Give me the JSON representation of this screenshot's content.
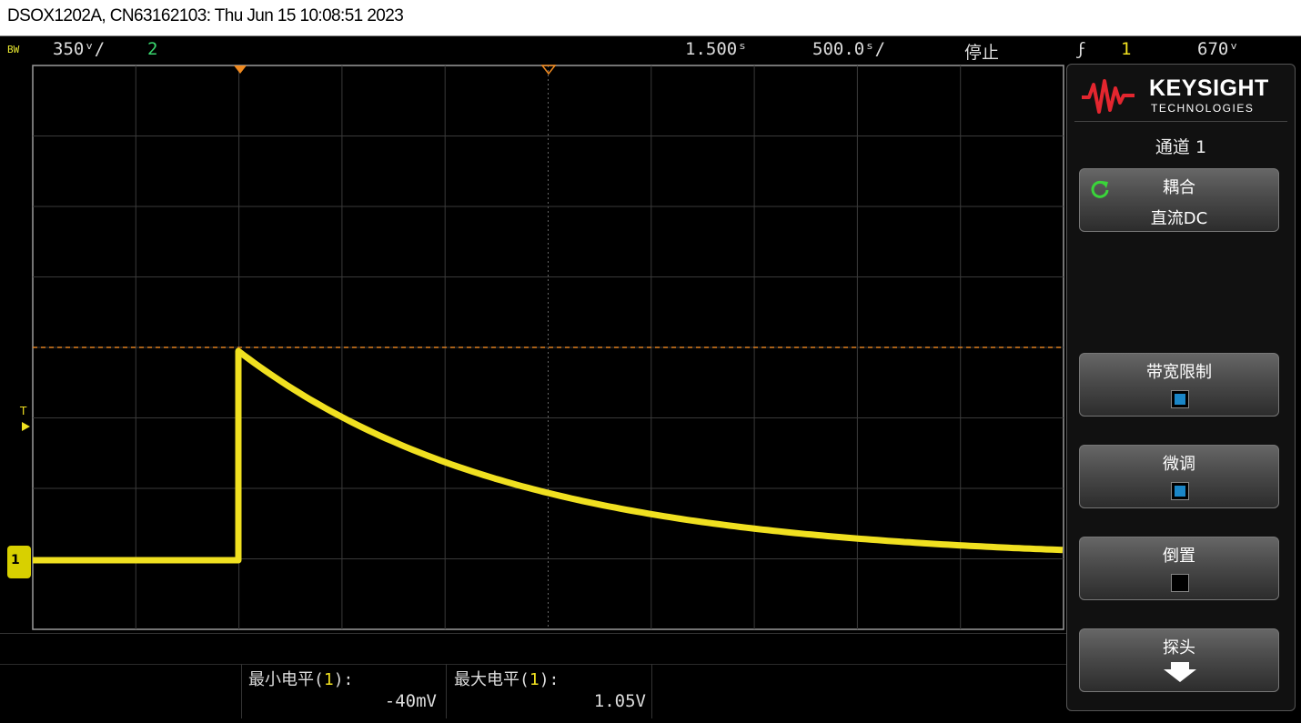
{
  "title_bar": {
    "text": "DSOX1202A, CN63162103: Thu Jun 15 10:08:51 2023"
  },
  "status": {
    "bw": "BW",
    "ch1_scale": "350ᵛ/",
    "ch2_label": "2",
    "time_offset": "1.500ˢ",
    "time_scale": "500.0ˢ/",
    "run_state": "停止",
    "trigger_symbol": "ϝ",
    "trigger_source": "1",
    "trigger_level": "670ᵛ"
  },
  "scope": {
    "trigger_marker_label": "T",
    "ground_marker_label": "1",
    "colors": {
      "channel1": "#f0e020",
      "trigger_level": "#e08020",
      "grid": "#3a3a3a"
    }
  },
  "measurements": [
    {
      "label_prefix": "最小电平(",
      "channel": "1",
      "label_suffix": "):",
      "value": "-40mV"
    },
    {
      "label_prefix": "最大电平(",
      "channel": "1",
      "label_suffix": "):",
      "value": "1.05V"
    }
  ],
  "panel": {
    "brand": "KEYSIGHT",
    "brand_sub": "TECHNOLOGIES",
    "title": "通道 1",
    "coupling_label": "耦合",
    "coupling_value": "直流DC",
    "bw_limit_label": "带宽限制",
    "bw_limit_checked": true,
    "fine_label": "微调",
    "fine_checked": true,
    "invert_label": "倒置",
    "invert_checked": false,
    "probe_label": "探头"
  }
}
